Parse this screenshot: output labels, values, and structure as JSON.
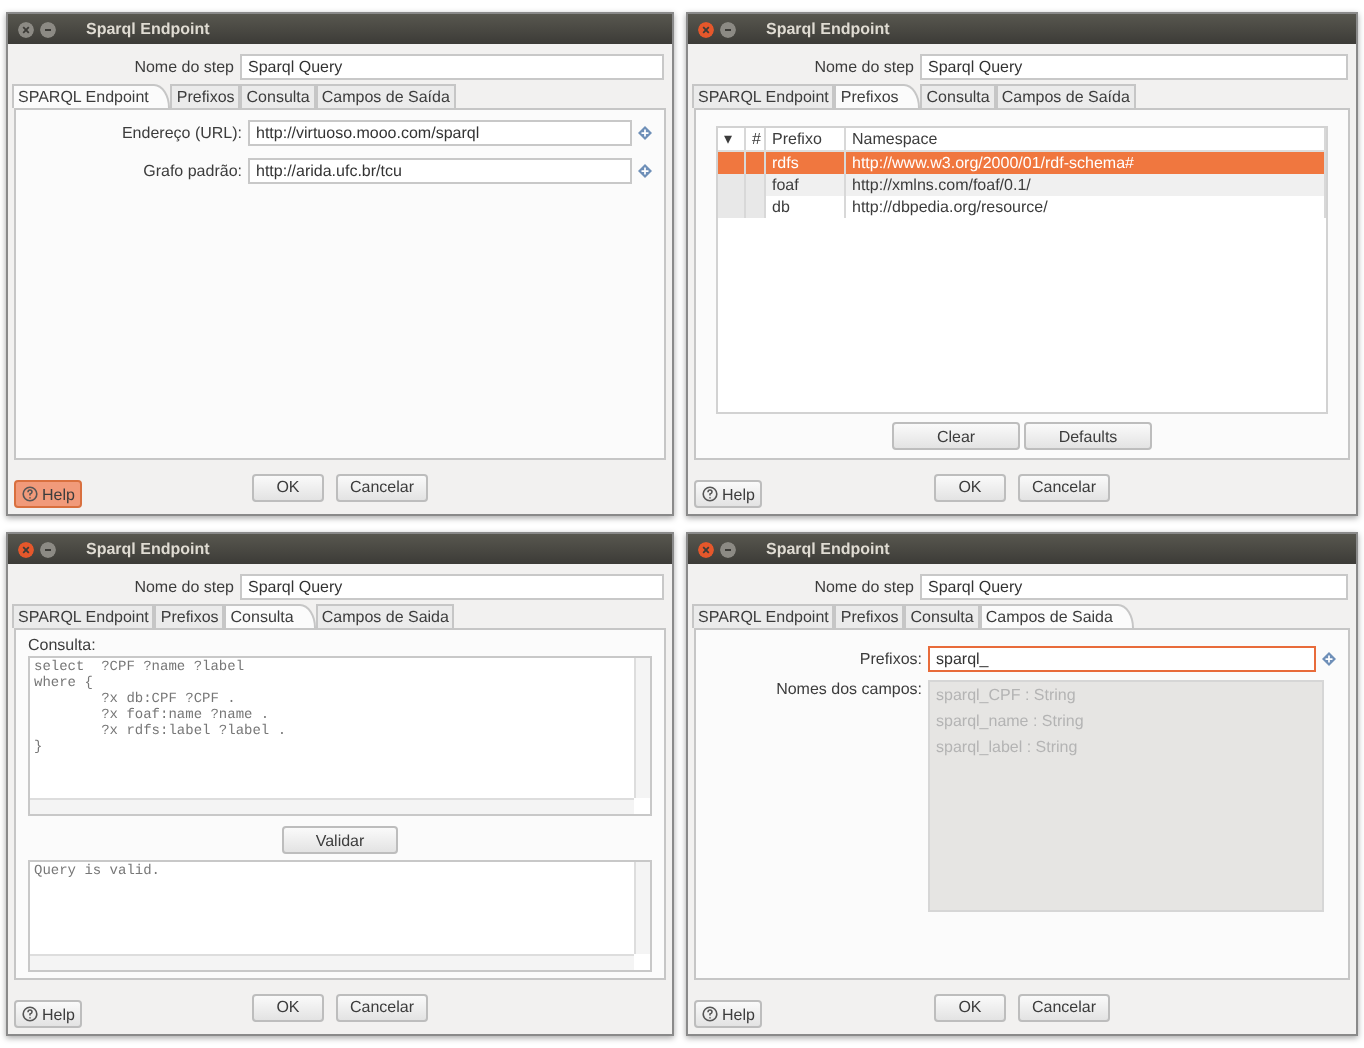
{
  "windows": [
    {
      "title": "Sparql Endpoint",
      "active": false,
      "step_label": "Nome do step",
      "step_value": "Sparql Query",
      "tabs": [
        {
          "label": "SPARQL Endpoint",
          "selected": true
        },
        {
          "label": "Prefixos",
          "selected": false
        },
        {
          "label": "Consulta",
          "selected": false
        },
        {
          "label": "Campos de Saída",
          "selected": false
        }
      ],
      "content": {
        "kind": "fields",
        "fields": [
          {
            "label": "Endereço (URL):",
            "value": "http://virtuoso.mooo.com/sparql"
          },
          {
            "label": "Grafo padrão:",
            "value": "http://arida.ufc.br/tcu"
          }
        ]
      },
      "ok": "OK",
      "cancel": "Cancelar",
      "help": {
        "label": "Help",
        "highlighted": true
      }
    },
    {
      "title": "Sparql Endpoint",
      "active": true,
      "step_label": "Nome do step",
      "step_value": "Sparql Query",
      "tabs": [
        {
          "label": "SPARQL Endpoint",
          "selected": false
        },
        {
          "label": "Prefixos",
          "selected": true
        },
        {
          "label": "Consulta",
          "selected": false
        },
        {
          "label": "Campos de Saída",
          "selected": false
        }
      ],
      "content": {
        "kind": "table",
        "columns": [
          "▾",
          "#",
          "Prefixo",
          "Namespace"
        ],
        "rows": [
          {
            "prefix": "rdfs",
            "namespace": "http://www.w3.org/2000/01/rdf-schema#",
            "selected": true
          },
          {
            "prefix": "foaf",
            "namespace": "http://xmlns.com/foaf/0.1/",
            "selected": false
          },
          {
            "prefix": "db",
            "namespace": "http://dbpedia.org/resource/",
            "selected": false
          }
        ],
        "buttons": [
          "Clear",
          "Defaults"
        ]
      },
      "ok": "OK",
      "cancel": "Cancelar",
      "help": {
        "label": "Help",
        "highlighted": false
      }
    },
    {
      "title": "Sparql Endpoint",
      "active": true,
      "step_label": "Nome do step",
      "step_value": "Sparql Query",
      "tabs": [
        {
          "label": "SPARQL Endpoint",
          "selected": false
        },
        {
          "label": "Prefixos",
          "selected": false
        },
        {
          "label": "Consulta",
          "selected": true
        },
        {
          "label": "Campos de Saida",
          "selected": false
        }
      ],
      "content": {
        "kind": "query",
        "label": "Consulta:",
        "query": "select  ?CPF ?name ?label\nwhere {\n        ?x db:CPF ?CPF .\n        ?x foaf:name ?name .\n        ?x rdfs:label ?label .\n}",
        "validate": "Validar",
        "result": "Query is valid."
      },
      "ok": "OK",
      "cancel": "Cancelar",
      "help": {
        "label": "Help",
        "highlighted": false
      }
    },
    {
      "title": "Sparql Endpoint",
      "active": true,
      "step_label": "Nome do step",
      "step_value": "Sparql Query",
      "tabs": [
        {
          "label": "SPARQL Endpoint",
          "selected": false
        },
        {
          "label": "Prefixos",
          "selected": false
        },
        {
          "label": "Consulta",
          "selected": false
        },
        {
          "label": "Campos de Saida",
          "selected": true
        }
      ],
      "content": {
        "kind": "output",
        "prefix_label": "Prefixos:",
        "prefix_value": "sparql_",
        "focused": true,
        "names_label": "Nomes dos campos:",
        "names_disabled": true,
        "names": [
          "sparql_CPF : String",
          "sparql_name : String",
          "sparql_label : String"
        ]
      },
      "ok": "OK",
      "cancel": "Cancelar",
      "help": {
        "label": "Help",
        "highlighted": false
      }
    }
  ]
}
